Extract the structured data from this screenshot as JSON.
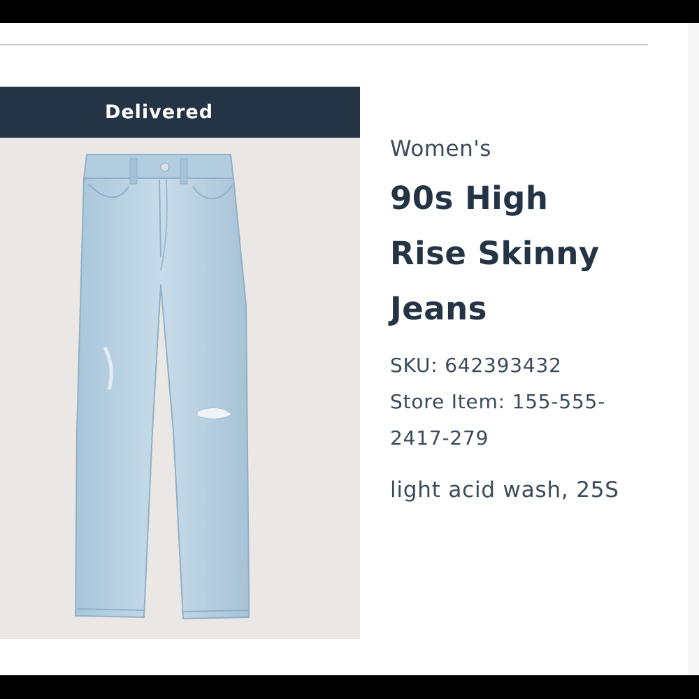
{
  "order_item": {
    "status": "Delivered",
    "category": "Women's",
    "title": "90s High Rise Skinny Jeans",
    "sku_label": "SKU: 642393432",
    "store_item_label": "Store Item: 155-555-2417-279",
    "variant": "light acid wash, 25S",
    "image": "light-wash-jeans-product-photo"
  },
  "colors": {
    "banner": "#243445",
    "text": "#243445",
    "image_background": "#ebe7e4",
    "denim": "#b9d2e2"
  }
}
